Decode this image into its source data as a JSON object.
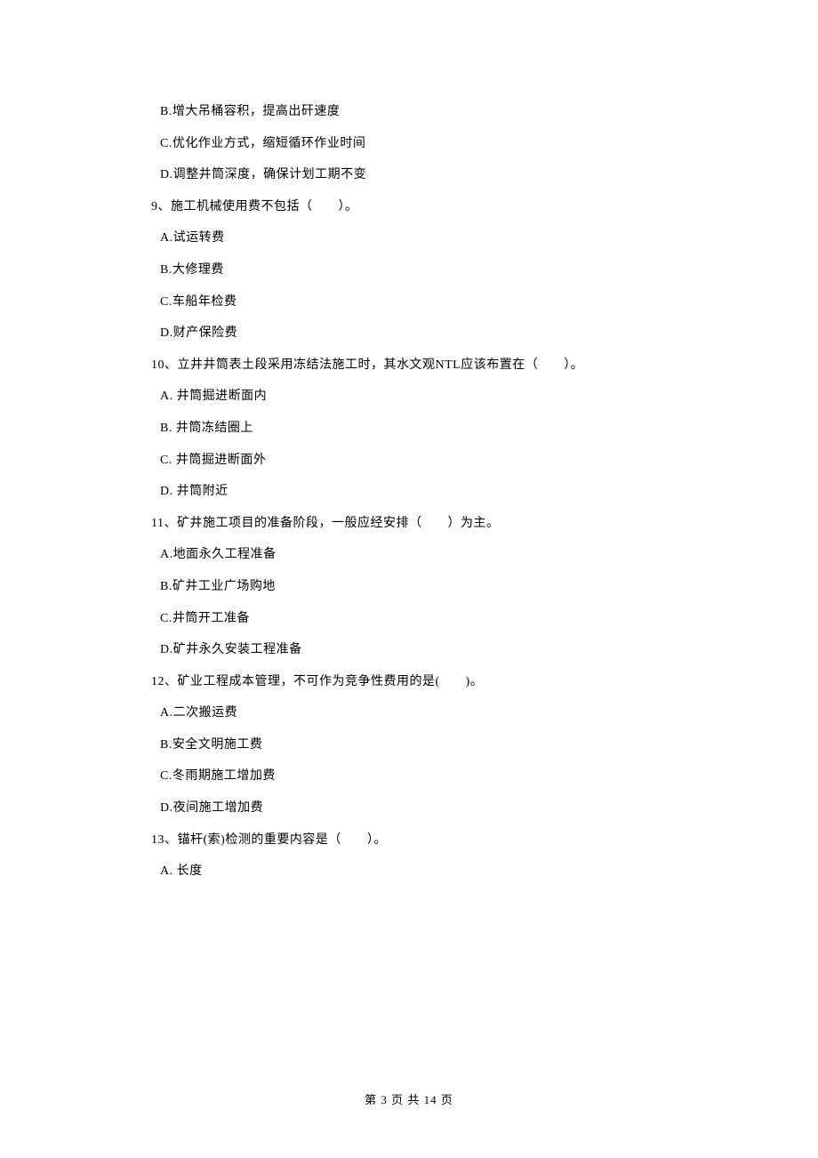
{
  "blocks": [
    {
      "type": "opt",
      "text": "B.增大吊桶容积，提高出矸速度"
    },
    {
      "type": "opt",
      "text": "C.优化作业方式，缩短循环作业时间"
    },
    {
      "type": "opt",
      "text": "D.调整井筒深度，确保计划工期不变"
    },
    {
      "type": "q",
      "text": "9、施工机械使用费不包括（　　）。"
    },
    {
      "type": "opt",
      "text": "A.试运转费"
    },
    {
      "type": "opt",
      "text": "B.大修理费"
    },
    {
      "type": "opt",
      "text": "C.车船年检费"
    },
    {
      "type": "opt",
      "text": "D.财产保险费"
    },
    {
      "type": "q",
      "text": "10、立井井筒表土段采用冻结法施工时，其水文观NTL应该布置在（　　）。"
    },
    {
      "type": "opt",
      "text": "A.  井筒掘进断面内"
    },
    {
      "type": "opt",
      "text": "B.  井筒冻结圈上"
    },
    {
      "type": "opt",
      "text": "C.  井筒掘进断面外"
    },
    {
      "type": "opt",
      "text": "D.  井筒附近"
    },
    {
      "type": "q",
      "text": "11、矿井施工项目的准备阶段，一般应经安排（　　）为主。"
    },
    {
      "type": "opt",
      "text": "A.地面永久工程准备"
    },
    {
      "type": "opt",
      "text": "B.矿井工业广场购地"
    },
    {
      "type": "opt",
      "text": "C.井筒开工准备"
    },
    {
      "type": "opt",
      "text": "D.矿井永久安装工程准备"
    },
    {
      "type": "q",
      "text": "12、矿业工程成本管理，不可作为竞争性费用的是(　　)。"
    },
    {
      "type": "opt",
      "text": "A.二次搬运费"
    },
    {
      "type": "opt",
      "text": "B.安全文明施工费"
    },
    {
      "type": "opt",
      "text": "C.冬雨期施工增加费"
    },
    {
      "type": "opt",
      "text": "D.夜间施工增加费"
    },
    {
      "type": "q",
      "text": "13、锚杆(索)检测的重要内容是（　　）。"
    },
    {
      "type": "opt",
      "text": "A.  长度"
    }
  ],
  "footer": "第 3 页 共 14 页"
}
